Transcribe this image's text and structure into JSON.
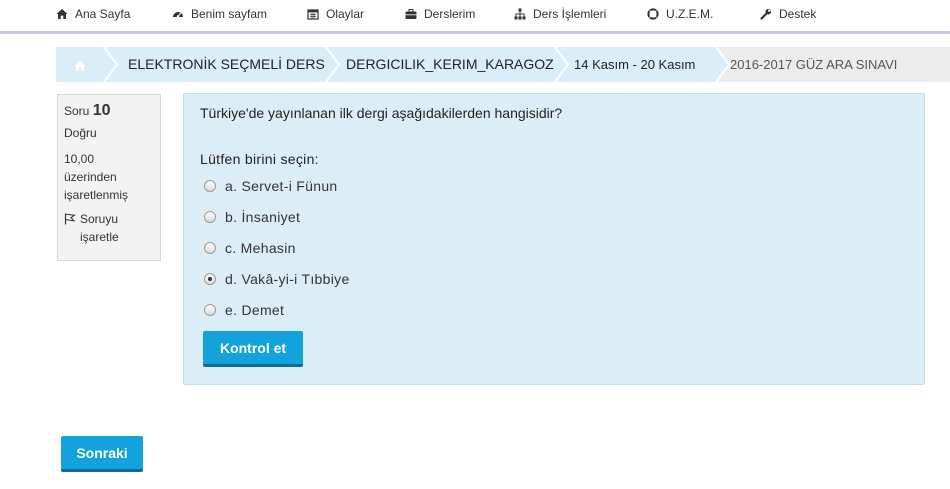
{
  "nav": {
    "items": [
      {
        "label": "Ana Sayfa",
        "icon": "home-icon"
      },
      {
        "label": "Benim sayfam",
        "icon": "dashboard-icon"
      },
      {
        "label": "Olaylar",
        "icon": "calendar-icon"
      },
      {
        "label": "Derslerim",
        "icon": "briefcase-icon"
      },
      {
        "label": "Ders İşlemleri",
        "icon": "sitemap-icon"
      },
      {
        "label": "U.Z.E.M.",
        "icon": "lifebuoy-icon"
      },
      {
        "label": "Destek",
        "icon": "wrench-icon"
      }
    ]
  },
  "breadcrumb": {
    "home_icon": "home-icon",
    "items": [
      {
        "label": "ELEKTRONİK SEÇMELİ DERS"
      },
      {
        "label": "DERGICILIK_KERIM_KARAGOZ"
      },
      {
        "label": "14 Kasım - 20 Kasım"
      },
      {
        "label": "2016-2017 GÜZ ARA SINAVI"
      }
    ]
  },
  "info": {
    "question_label": "Soru",
    "question_number": "10",
    "status": "Doğru",
    "mark_line1": "10,00",
    "mark_line2": "üzerinden",
    "mark_line3": "işaretlenmiş",
    "flag_line1": "Soruyu",
    "flag_line2": "işaretle"
  },
  "question": {
    "text": "Türkiye'de yayınlanan ilk dergi aşağıdakilerden hangisidir?",
    "prompt": "Lütfen birini seçin:",
    "options": [
      {
        "label": "a. Servet-i Fünun",
        "selected": false
      },
      {
        "label": "b. İnsaniyet",
        "selected": false
      },
      {
        "label": "c. Mehasin",
        "selected": false
      },
      {
        "label": "d. Vakâ-yi-i Tıbbiye",
        "selected": true
      },
      {
        "label": "e. Demet",
        "selected": false
      }
    ],
    "check_button": "Kontrol et"
  },
  "next_button": "Sonraki",
  "colors": {
    "accent": "#13a2db",
    "breadcrumb_active": "#d9eef7",
    "breadcrumb_current": "#ececec",
    "question_bg": "#dbeef7"
  }
}
